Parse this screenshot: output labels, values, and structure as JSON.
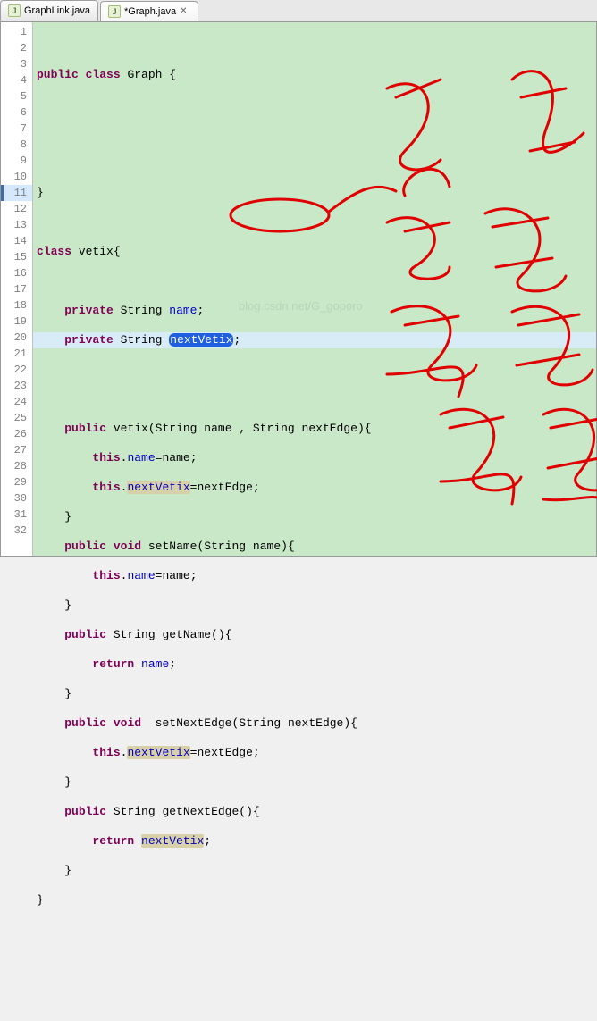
{
  "tabs": [
    {
      "icon_label": "J",
      "label": "GraphLink.java",
      "active": false
    },
    {
      "icon_label": "J",
      "label": "*Graph.java",
      "active": true
    }
  ],
  "line_count": 32,
  "highlighted_line": 11,
  "tokens": {
    "kw_public": "public",
    "kw_class": "class",
    "kw_private": "private",
    "kw_void": "void",
    "kw_return": "return",
    "kw_this": "this",
    "type_string": "String",
    "cls_graph": "Graph",
    "cls_vetix": "vetix",
    "id_name": "name",
    "id_nextVetix": "nextVetix",
    "id_nextEdge": "nextEdge",
    "fn_vetix": "vetix",
    "fn_setName": "setName",
    "fn_getName": "getName",
    "fn_setNextEdge": "setNextEdge",
    "fn_getNextEdge": "getNextEdge",
    "open_brace": "{",
    "close_brace": "}",
    "open_paren": "(",
    "close_paren": ")",
    "semi": ";",
    "comma": ",",
    "space_comma_space": " , ",
    "dot": ".",
    "eq": "="
  },
  "watermark": "blog.csdn.net/G_goporo"
}
